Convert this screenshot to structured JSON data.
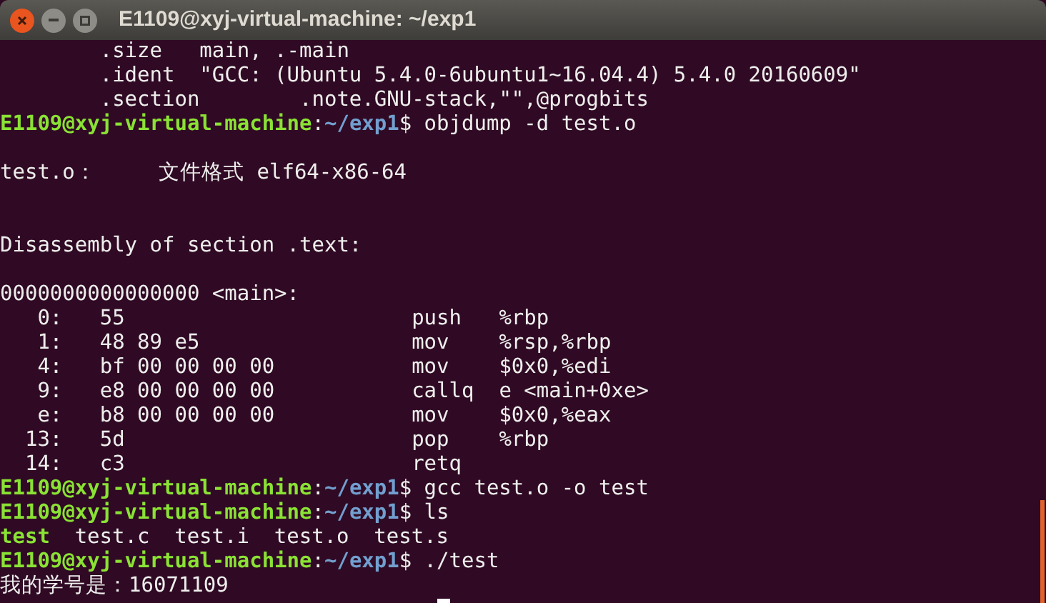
{
  "window": {
    "title": "E1109@xyj-virtual-machine: ~/exp1"
  },
  "terminal": {
    "lines": [
      {
        "kind": "text",
        "text": "        .size   main, .-main"
      },
      {
        "kind": "text",
        "text": "        .ident  \"GCC: (Ubuntu 5.4.0-6ubuntu1~16.04.4) 5.4.0 20160609\""
      },
      {
        "kind": "text",
        "text": "        .section        .note.GNU-stack,\"\",@progbits"
      },
      {
        "kind": "prompt",
        "user_host": "E1109@xyj-virtual-machine",
        "separator": ":",
        "path": "~/exp1",
        "symbol": "$",
        "command": "objdump -d test.o"
      },
      {
        "kind": "blank"
      },
      {
        "kind": "text",
        "text": "test.o：     文件格式 elf64-x86-64"
      },
      {
        "kind": "blank"
      },
      {
        "kind": "blank"
      },
      {
        "kind": "text",
        "text": "Disassembly of section .text:"
      },
      {
        "kind": "blank"
      },
      {
        "kind": "text",
        "text": "0000000000000000 <main>:"
      },
      {
        "kind": "text",
        "text": "   0:   55                       push   %rbp"
      },
      {
        "kind": "text",
        "text": "   1:   48 89 e5                 mov    %rsp,%rbp"
      },
      {
        "kind": "text",
        "text": "   4:   bf 00 00 00 00           mov    $0x0,%edi"
      },
      {
        "kind": "text",
        "text": "   9:   e8 00 00 00 00           callq  e <main+0xe>"
      },
      {
        "kind": "text",
        "text": "   e:   b8 00 00 00 00           mov    $0x0,%eax"
      },
      {
        "kind": "text",
        "text": "  13:   5d                       pop    %rbp"
      },
      {
        "kind": "text",
        "text": "  14:   c3                       retq"
      },
      {
        "kind": "prompt",
        "user_host": "E1109@xyj-virtual-machine",
        "separator": ":",
        "path": "~/exp1",
        "symbol": "$",
        "command": "gcc test.o -o test"
      },
      {
        "kind": "prompt",
        "user_host": "E1109@xyj-virtual-machine",
        "separator": ":",
        "path": "~/exp1",
        "symbol": "$",
        "command": "ls"
      },
      {
        "kind": "files",
        "files": [
          {
            "name": "test",
            "executable": true
          },
          {
            "name": "test.c",
            "executable": false
          },
          {
            "name": "test.i",
            "executable": false
          },
          {
            "name": "test.o",
            "executable": false
          },
          {
            "name": "test.s",
            "executable": false
          }
        ]
      },
      {
        "kind": "prompt",
        "user_host": "E1109@xyj-virtual-machine",
        "separator": ":",
        "path": "~/exp1",
        "symbol": "$",
        "command": "./test"
      },
      {
        "kind": "text",
        "text": "我的学号是：16071109"
      },
      {
        "kind": "cursor"
      }
    ]
  }
}
